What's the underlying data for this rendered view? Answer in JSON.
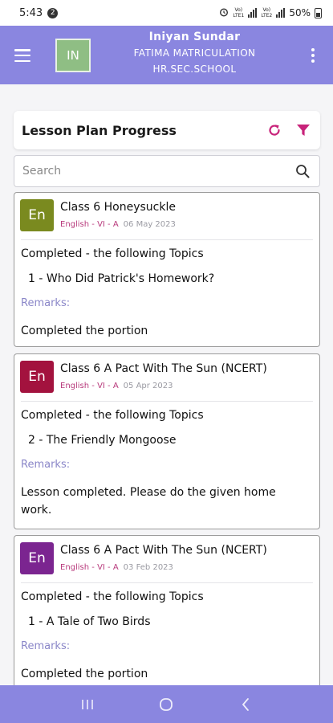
{
  "status_bar": {
    "time": "5:43",
    "notification_count": "2",
    "network_1": "Vo) LTE1",
    "network_2": "Vo) LTE2",
    "battery": "50%"
  },
  "header": {
    "avatar_initials": "IN",
    "user_name": "Iniyan Sundar",
    "school_line1": "FATIMA MATRICULATION",
    "school_line2": "HR.SEC.SCHOOL"
  },
  "page": {
    "title": "Lesson Plan Progress"
  },
  "search": {
    "placeholder": "Search"
  },
  "lessons": [
    {
      "avatar": "En",
      "avatar_color": "#7a8a1f",
      "title": "Class 6 Honeysuckle",
      "subject": "English - VI - A",
      "date": "06 May 2023",
      "completed_label": "Completed - the following Topics",
      "topic": "1 - Who Did Patrick's Homework?",
      "remarks_label": "Remarks:",
      "remarks": "Completed the portion"
    },
    {
      "avatar": "En",
      "avatar_color": "#a3123e",
      "title": "Class 6 A Pact With The Sun (NCERT)",
      "subject": "English - VI - A",
      "date": "05 Apr 2023",
      "completed_label": "Completed - the following Topics",
      "topic": "2 - The Friendly Mongoose",
      "remarks_label": "Remarks:",
      "remarks": "Lesson completed. Please do the given home work."
    },
    {
      "avatar": "En",
      "avatar_color": "#7b2590",
      "title": "Class 6 A Pact With The Sun (NCERT)",
      "subject": "English - VI - A",
      "date": "03 Feb 2023",
      "completed_label": "Completed - the following Topics",
      "topic": "1 - A Tale of Two Birds",
      "remarks_label": "Remarks:",
      "remarks": "Completed the portion"
    }
  ],
  "colors": {
    "header_bg": "#8a86e0",
    "accent_pink": "#c8237a",
    "subject_text": "#b83a7c",
    "remarks_label": "#8a86c8"
  },
  "icons": {
    "menu": "hamburger-menu-icon",
    "more": "vertical-dots-icon",
    "refresh": "refresh-icon",
    "filter": "filter-icon",
    "search": "search-icon"
  }
}
